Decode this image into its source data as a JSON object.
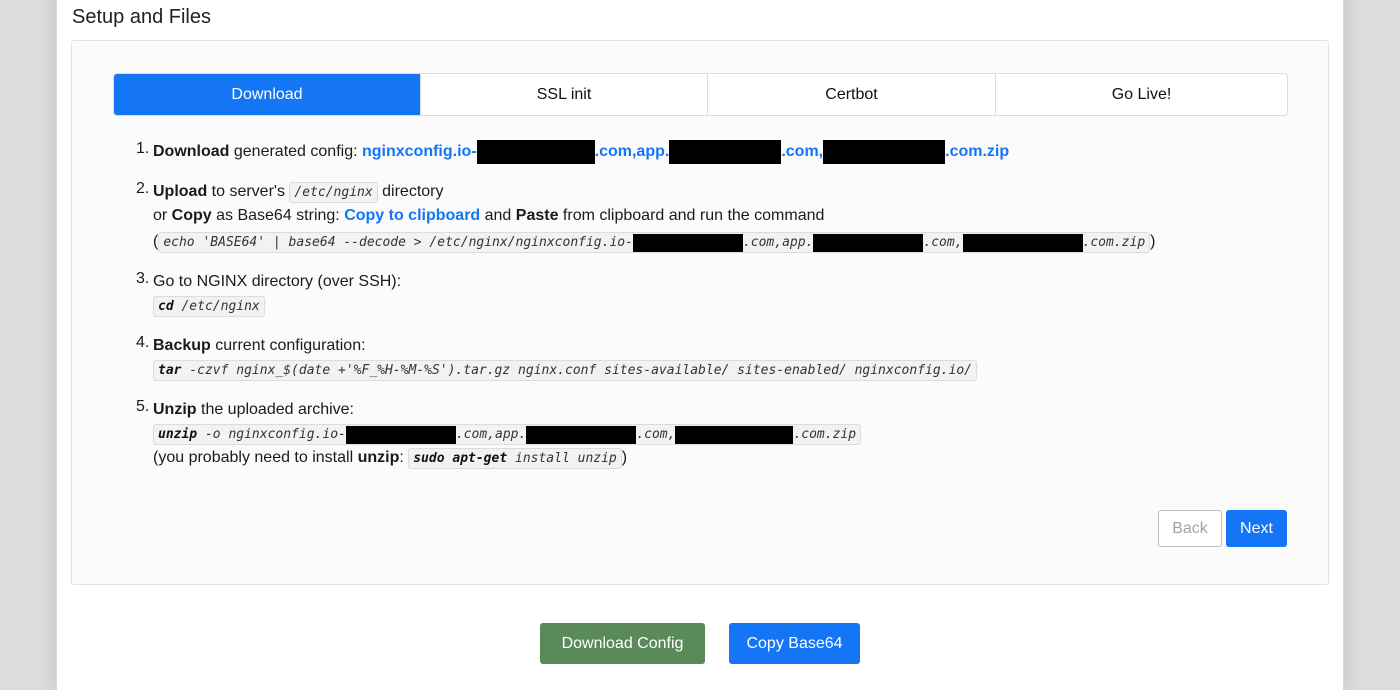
{
  "section": {
    "title": "Setup and Files"
  },
  "tabs": [
    {
      "label": "Download",
      "active": true
    },
    {
      "label": "SSL init"
    },
    {
      "label": "Certbot"
    },
    {
      "label": "Go Live!"
    }
  ],
  "steps": {
    "s1": {
      "num": "1.",
      "bold": "Download",
      "text": " generated config: ",
      "link_a": "nginxconfig.io-",
      "link_b": ".com,app.",
      "link_c": ".com,",
      "link_d": ".com.zip"
    },
    "s2": {
      "num": "2.",
      "bold": "Upload",
      "text1": " to server's ",
      "path": "/etc/nginx",
      "text2": " directory",
      "prefix": "or ",
      "copy_bold": "Copy",
      "text3": " as Base64 string: ",
      "copy_link": "Copy to clipboard",
      "text4": " and ",
      "paste_bold": "Paste",
      "text5": " from clipboard and run the command",
      "open_paren": "(",
      "cmd_a": "echo 'BASE64' | base64 --decode > /etc/nginx/nginxconfig.io-",
      "cmd_b": ".com,app.",
      "cmd_c": ".com,",
      "cmd_d": ".com.zip",
      "close_paren": ")"
    },
    "s3": {
      "num": "3.",
      "text": "Go to NGINX directory (over SSH):",
      "cmd_bold": "cd",
      "cmd_rest": " /etc/nginx"
    },
    "s4": {
      "num": "4.",
      "bold": "Backup",
      "text": " current configuration:",
      "cmd_bold": "tar",
      "cmd_rest": " -czvf nginx_$(date +'%F_%H-%M-%S').tar.gz nginx.conf sites-available/ sites-enabled/ nginxconfig.io/"
    },
    "s5": {
      "num": "5.",
      "bold": "Unzip",
      "text": " the uploaded archive:",
      "cmd_bold": "unzip",
      "cmd_a": " -o nginxconfig.io-",
      "cmd_b": ".com,app.",
      "cmd_c": ".com,",
      "cmd_d": ".com.zip",
      "note_a": "(you probably need to install ",
      "note_bold": "unzip",
      "note_b": ": ",
      "note_cmd_bold1": "sudo",
      "note_cmd_bold2": "apt-get",
      "note_cmd_rest": " install unzip",
      "note_c": ")"
    }
  },
  "nav": {
    "back": "Back",
    "next": "Next"
  },
  "actions": {
    "download": "Download Config",
    "copy": "Copy Base64"
  },
  "colors": {
    "primary": "#1475f5",
    "download_button": "#5a8a5a"
  }
}
